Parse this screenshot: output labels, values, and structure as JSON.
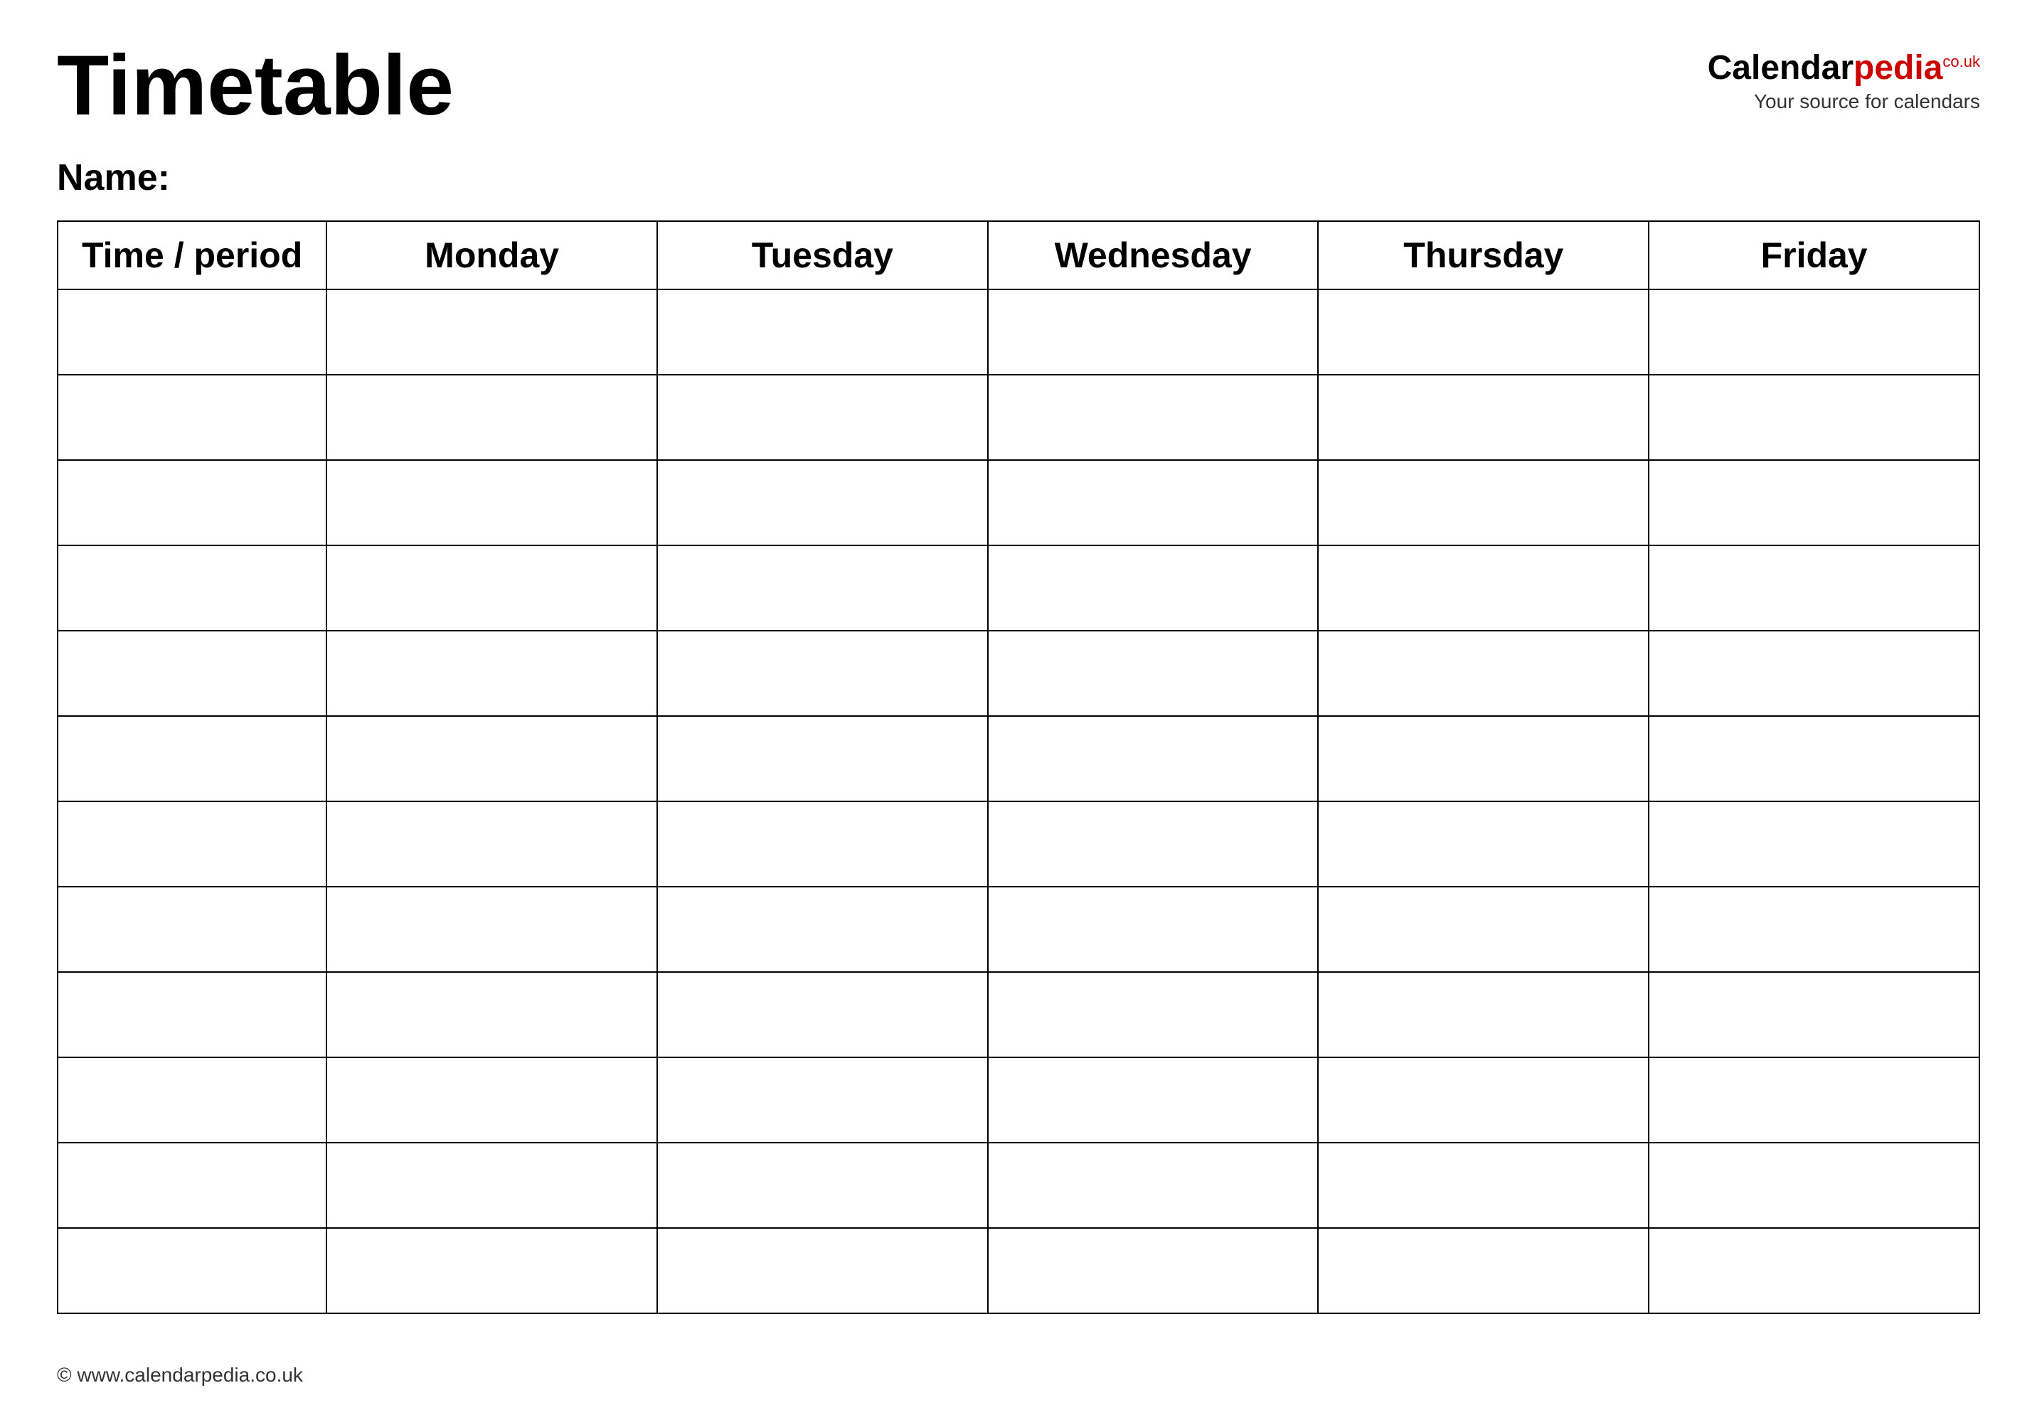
{
  "header": {
    "title": "Timetable",
    "logo": {
      "calendar_text": "Calendar",
      "pedia_text": "pedia",
      "co_text": "co.uk",
      "tagline": "Your source for calendars"
    }
  },
  "name_section": {
    "label": "Name:"
  },
  "table": {
    "headers": [
      "Time / period",
      "Monday",
      "Tuesday",
      "Wednesday",
      "Thursday",
      "Friday"
    ],
    "row_count": 12
  },
  "footer": {
    "url": "© www.calendarpedia.co.uk"
  }
}
